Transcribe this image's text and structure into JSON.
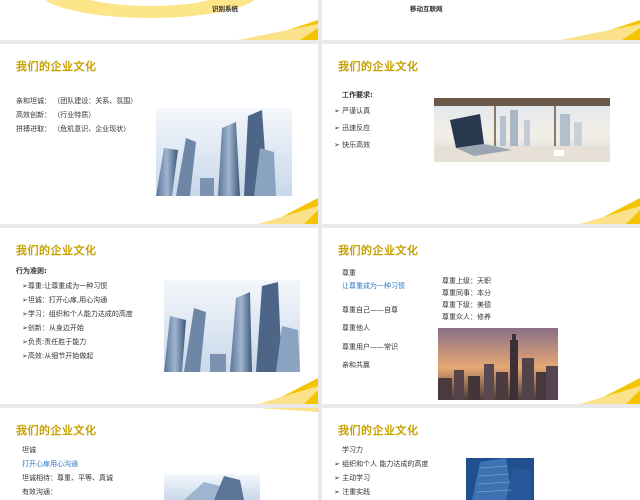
{
  "top_left": {
    "caption": "识别系统"
  },
  "top_right": {
    "caption": "移动互联网"
  },
  "slide1": {
    "title": "我们的企业文化",
    "lines": [
      "亲和坦诚： （团队建设：关系、氛围）",
      "高效创新： （行业特质）",
      "拼搏进取： （危机意识、企业现状）"
    ]
  },
  "slide2": {
    "title": "我们的企业文化",
    "heading": "工作要求:",
    "items": [
      "严谨认真",
      "迅速反应",
      "快乐高效"
    ]
  },
  "slide3": {
    "title": "我们的企业文化",
    "heading": "行为准则:",
    "items": [
      "➢尊重:让尊重成为一种习惯",
      "➢坦诚：打开心扉,用心沟通",
      "➢学习：组织和个人能力达成的高度",
      "➢创新：从身边开始",
      "➢负责:责任胜于能力",
      "➢高效:从细节开始做起"
    ]
  },
  "slide4": {
    "title": "我们的企业文化",
    "left": [
      "尊重",
      "让尊重成为一种习惯",
      "尊重自己——自尊",
      "尊重他人",
      "尊重用户——常识",
      "亲和共赢"
    ],
    "right": [
      "尊重上级：天职",
      "尊重同事：本分",
      "尊重下级：美德",
      "尊重众人：修养"
    ]
  },
  "slide5": {
    "title": "我们的企业文化",
    "lines": [
      "坦诚",
      "打开心扉用心沟通",
      "坦诚相待：尊重、平等、真诚",
      "有效沟通："
    ]
  },
  "slide6": {
    "title": "我们的企业文化",
    "heading": "学习力",
    "items": [
      "组织和个人 能力达成的高度",
      "主动学习",
      "注重实践"
    ]
  },
  "colors": {
    "title": "#c8a200",
    "accent_yellow": "#f5c400",
    "link_blue": "#2d7ac6"
  }
}
